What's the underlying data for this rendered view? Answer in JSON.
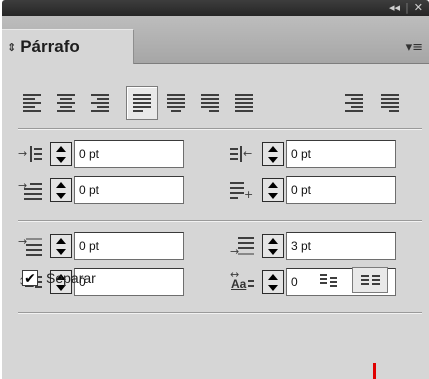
{
  "window": {
    "title_buttons": {
      "collapse": "◂◂",
      "separator": "|",
      "close": "✕"
    }
  },
  "tab": {
    "arrows": "⇕",
    "label": "Párrafo",
    "menu_glyph": "▾≡"
  },
  "alignment": {
    "buttons": [
      {
        "name": "align-left",
        "active": false
      },
      {
        "name": "align-center",
        "active": false
      },
      {
        "name": "align-right",
        "active": false
      },
      {
        "name": "justify-last-left",
        "active": true
      },
      {
        "name": "justify-last-center",
        "active": false
      },
      {
        "name": "justify-last-right",
        "active": false
      },
      {
        "name": "justify-all",
        "active": false
      },
      {
        "name": "align-towards-spine",
        "active": false
      },
      {
        "name": "align-away-from-spine",
        "active": false
      }
    ]
  },
  "indents": {
    "left_indent": "0 pt",
    "right_indent": "0 pt",
    "first_line_indent": "0 pt",
    "last_line_indent": "0 pt"
  },
  "spacing": {
    "space_before": "0 pt",
    "space_after": "3 pt",
    "drop_cap_lines": "0",
    "drop_cap_chars": "0"
  },
  "hyphenate": {
    "label": "Separar",
    "checked": true,
    "check_glyph": "✔"
  },
  "composer": {
    "single_line_active": false,
    "every_line_active": true
  },
  "colors": {
    "panel_bg": "#d6d6d6",
    "titlebar": "#2e2e2e",
    "cursor": "#e00000"
  }
}
